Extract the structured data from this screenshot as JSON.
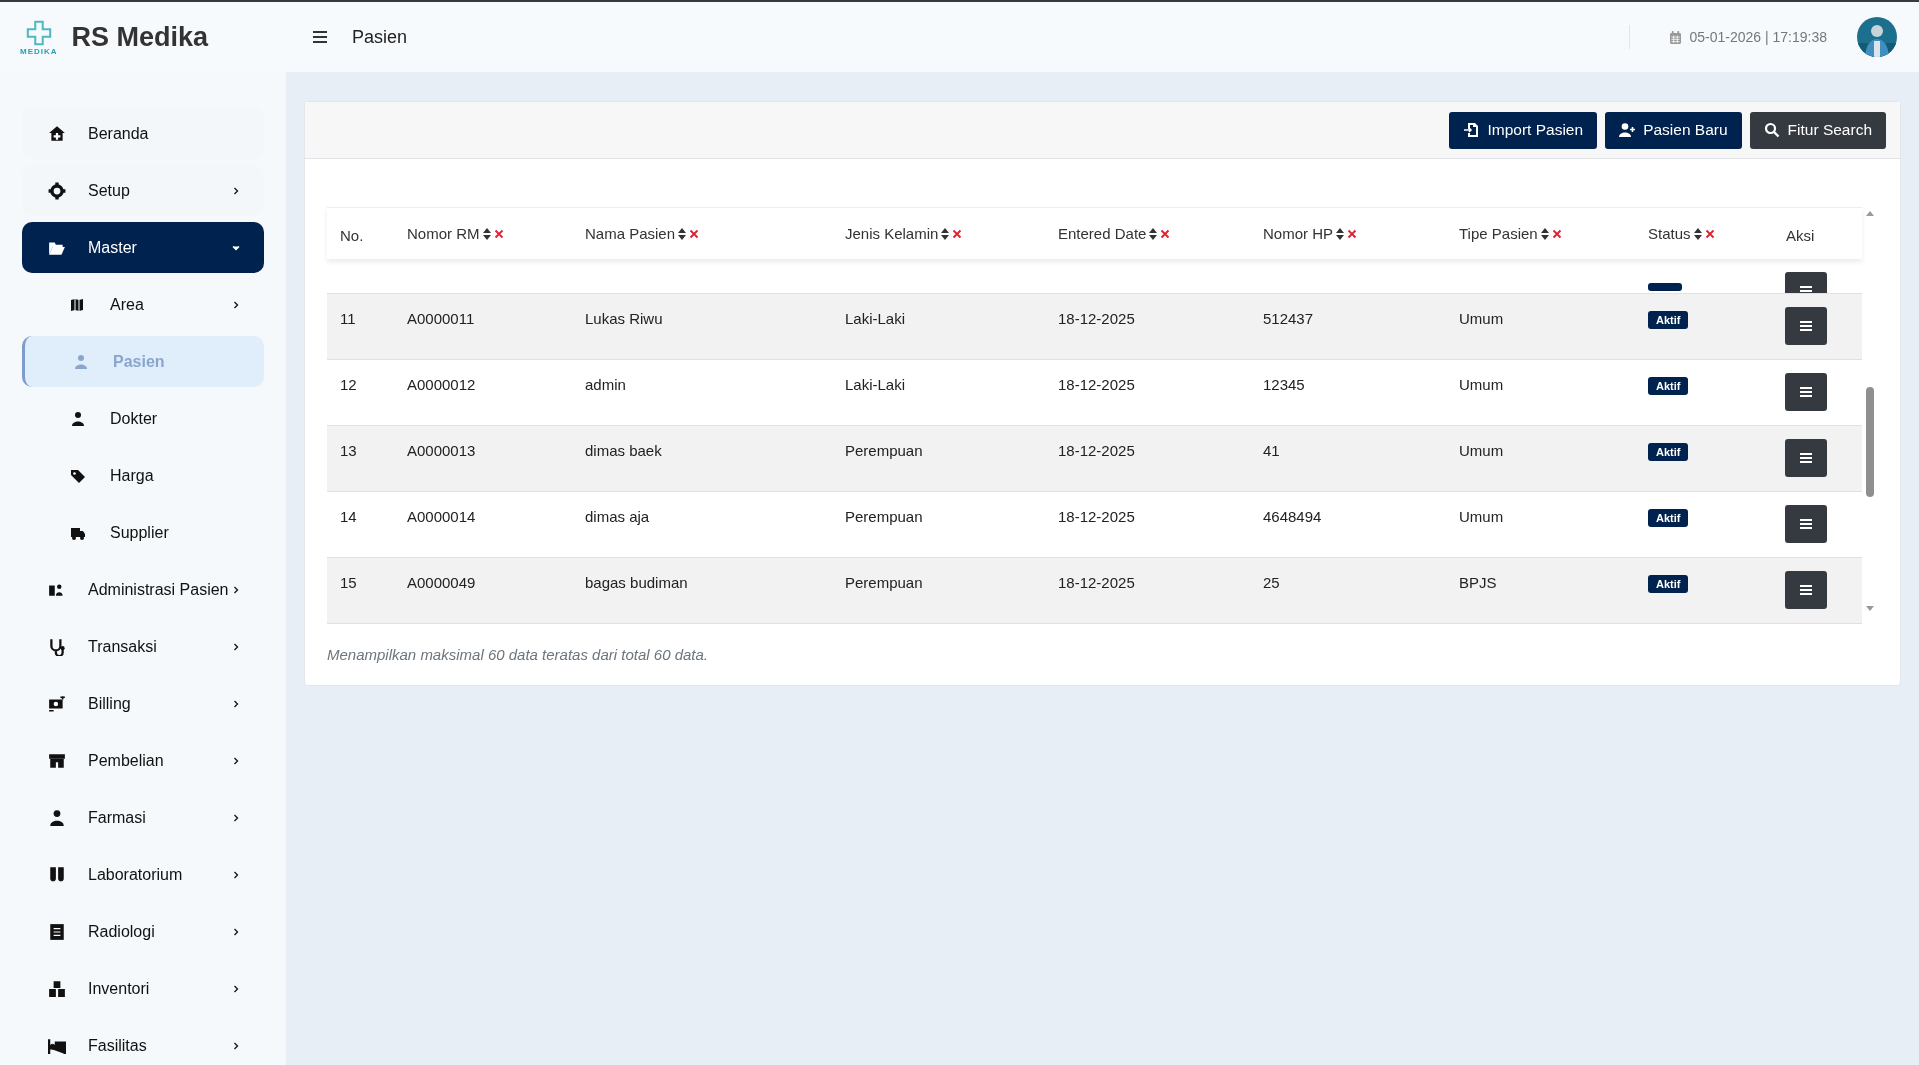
{
  "brand": {
    "logo_text": "MEDIKA",
    "name": "RS Medika"
  },
  "header": {
    "title": "Pasien",
    "datetime": "05-01-2026 | 17:19:38"
  },
  "sidebar": {
    "items": [
      {
        "label": "Beranda",
        "selected": false,
        "has_submenu": false,
        "expanded": false
      },
      {
        "label": "Setup",
        "selected": false,
        "has_submenu": true,
        "expanded": false
      },
      {
        "label": "Master",
        "selected": false,
        "has_submenu": true,
        "expanded": true,
        "children": [
          {
            "label": "Area",
            "selected": false,
            "has_submenu": true
          },
          {
            "label": "Pasien",
            "selected": true,
            "has_submenu": false
          },
          {
            "label": "Dokter",
            "selected": false,
            "has_submenu": false
          },
          {
            "label": "Harga",
            "selected": false,
            "has_submenu": false
          },
          {
            "label": "Supplier",
            "selected": false,
            "has_submenu": false
          }
        ]
      },
      {
        "label": "Administrasi Pasien",
        "selected": false,
        "has_submenu": true,
        "expanded": false
      },
      {
        "label": "Transaksi",
        "selected": false,
        "has_submenu": true,
        "expanded": false
      },
      {
        "label": "Billing",
        "selected": false,
        "has_submenu": true,
        "expanded": false
      },
      {
        "label": "Pembelian",
        "selected": false,
        "has_submenu": true,
        "expanded": false
      },
      {
        "label": "Farmasi",
        "selected": false,
        "has_submenu": true,
        "expanded": false
      },
      {
        "label": "Laboratorium",
        "selected": false,
        "has_submenu": true,
        "expanded": false
      },
      {
        "label": "Radiologi",
        "selected": false,
        "has_submenu": true,
        "expanded": false
      },
      {
        "label": "Inventori",
        "selected": false,
        "has_submenu": true,
        "expanded": false
      },
      {
        "label": "Fasilitas",
        "selected": false,
        "has_submenu": true,
        "expanded": false
      }
    ]
  },
  "toolbar": {
    "buttons": [
      {
        "label": "Import Pasien",
        "kind": "primary"
      },
      {
        "label": "Pasien Baru",
        "kind": "primary"
      },
      {
        "label": "Fitur Search",
        "kind": "dark"
      }
    ]
  },
  "table": {
    "columns": [
      {
        "label": "No.",
        "sortable": false
      },
      {
        "label": "Nomor RM",
        "sortable": true
      },
      {
        "label": "Nama Pasien",
        "sortable": true
      },
      {
        "label": "Jenis Kelamin",
        "sortable": true
      },
      {
        "label": "Entered Date",
        "sortable": true
      },
      {
        "label": "Nomor HP",
        "sortable": true
      },
      {
        "label": "Tipe Pasien",
        "sortable": true
      },
      {
        "label": "Status",
        "sortable": true
      },
      {
        "label": "Aksi",
        "sortable": false
      }
    ],
    "rows": [
      {
        "kind": "cut"
      },
      {
        "kind": "full",
        "cells": [
          "11",
          "A0000011",
          "Lukas Riwu",
          "Laki-Laki",
          "18-12-2025",
          "512437",
          "Umum"
        ],
        "status": "Aktif"
      },
      {
        "kind": "full",
        "cells": [
          "12",
          "A0000012",
          "admin",
          "Laki-Laki",
          "18-12-2025",
          "12345",
          "Umum"
        ],
        "status": "Aktif"
      },
      {
        "kind": "full",
        "cells": [
          "13",
          "A0000013",
          "dimas baek",
          "Perempuan",
          "18-12-2025",
          "41",
          "Umum"
        ],
        "status": "Aktif"
      },
      {
        "kind": "full",
        "cells": [
          "14",
          "A0000014",
          "dimas aja",
          "Perempuan",
          "18-12-2025",
          "4648494",
          "Umum"
        ],
        "status": "Aktif"
      },
      {
        "kind": "full",
        "cells": [
          "15",
          "A0000049",
          "bagas budiman",
          "Perempuan",
          "18-12-2025",
          "25",
          "BPJS"
        ],
        "status": "Aktif"
      }
    ],
    "footer": "Menampilkan maksimal 60 data teratas dari total 60 data."
  }
}
